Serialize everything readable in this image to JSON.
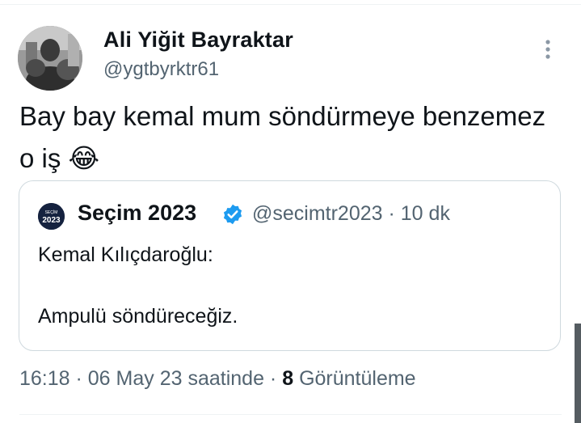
{
  "tweet": {
    "author_name": "Ali Yiğit Bayraktar",
    "author_handle": "@ygtbyrktr61",
    "text": "Bay bay kemal mum söndürmeye benzemez o iş",
    "emoji": "😂",
    "timestamp": "16:18 · 06 May 23 saatinde",
    "views_count": "8",
    "views_label": "Görüntüleme",
    "separator": " · "
  },
  "quoted": {
    "author_name": "Seçim 2023",
    "author_handle": "@secimtr2023",
    "time_ago": "10 dk",
    "meta_separator": " · ",
    "text": "Kemal Kılıçdaroğlu:\n\nAmpulü söndüreceğiz.",
    "logo_text_top": "SEÇİM",
    "logo_text_bottom": "2023"
  },
  "colors": {
    "verified_badge": "#1d9bf0",
    "secondary_text": "#536471",
    "border": "#cfd9de"
  },
  "icons": {
    "more": "more-vertical-icon",
    "verified": "verified-badge-icon"
  }
}
